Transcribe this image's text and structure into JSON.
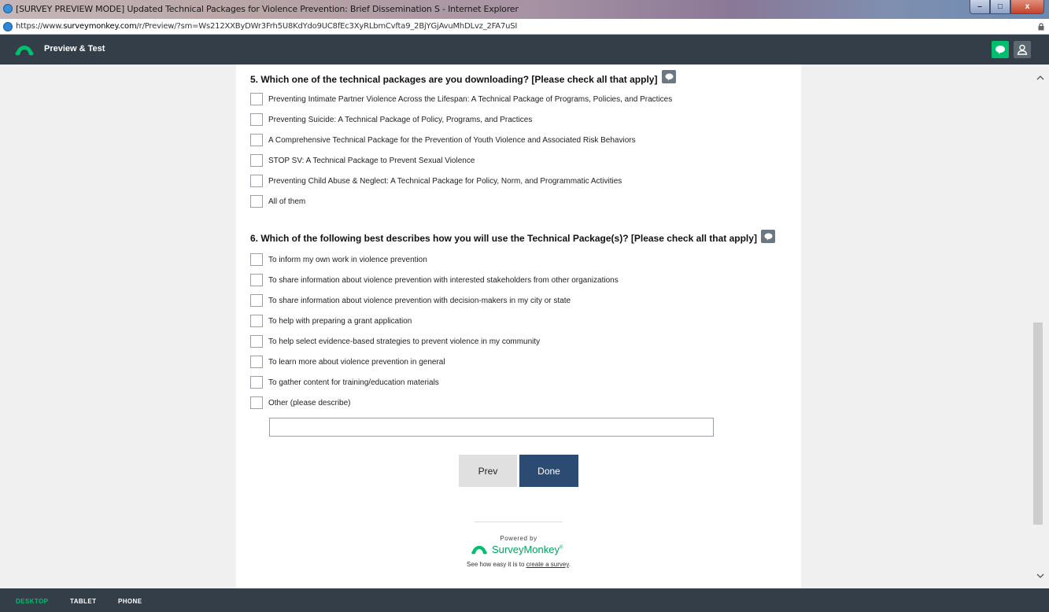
{
  "window": {
    "title": "[SURVEY PREVIEW MODE] Updated Technical Packages for Violence Prevention: Brief Dissemination S - Internet Explorer",
    "min_label": "–",
    "max_label": "□",
    "close_label": "x"
  },
  "address": {
    "scheme": "https://www.",
    "host": "surveymonkey.com",
    "path": "/r/Preview/?sm=Ws212XXByDWr3Frh5U8KdYdo9UC8fEc3XyRLbmCvfta9_2BjYGjAvuMhDLvz_2FA7uSI"
  },
  "header": {
    "title": "Preview & Test"
  },
  "questions": [
    {
      "title": "5. Which one of the technical packages are you downloading? [Please check all that apply]",
      "options": [
        "Preventing Intimate Partner Violence Across the Lifespan: A Technical Package of Programs, Policies, and Practices",
        "Preventing Suicide: A Technical Package of Policy, Programs, and Practices",
        "A Comprehensive Technical Package for the Prevention of Youth Violence and Associated Risk Behaviors",
        "STOP SV:  A Technical Package to Prevent Sexual Violence",
        "Preventing Child Abuse & Neglect: A Technical Package for Policy, Norm, and Programmatic Activities",
        "All of them"
      ]
    },
    {
      "title": "6. Which of the following best describes how you will use the Technical Package(s)? [Please check all that apply]",
      "options": [
        "To inform my own work in violence prevention",
        "To share information about violence prevention with interested stakeholders from other organizations",
        "To share information about violence prevention with decision-makers in my city or state",
        "To help with preparing a grant application",
        "To help select evidence-based strategies to prevent violence in my community",
        "To learn more about violence prevention in general",
        "To gather content for training/education materials",
        "Other (please describe)"
      ],
      "other_value": ""
    }
  ],
  "buttons": {
    "prev": "Prev",
    "done": "Done"
  },
  "footer": {
    "powered_by": "Powered by",
    "brand": "SurveyMonkey",
    "brand_mark": "®",
    "see_how_prefix": "See how easy it is to ",
    "create_link": "create a survey",
    "see_how_suffix": "."
  },
  "devices": {
    "desktop": "DESKTOP",
    "tablet": "TABLET",
    "phone": "PHONE",
    "active": "desktop"
  },
  "colors": {
    "brand_green": "#00bf6f",
    "header_bg": "#333e48",
    "done_button": "#2c4b73"
  }
}
